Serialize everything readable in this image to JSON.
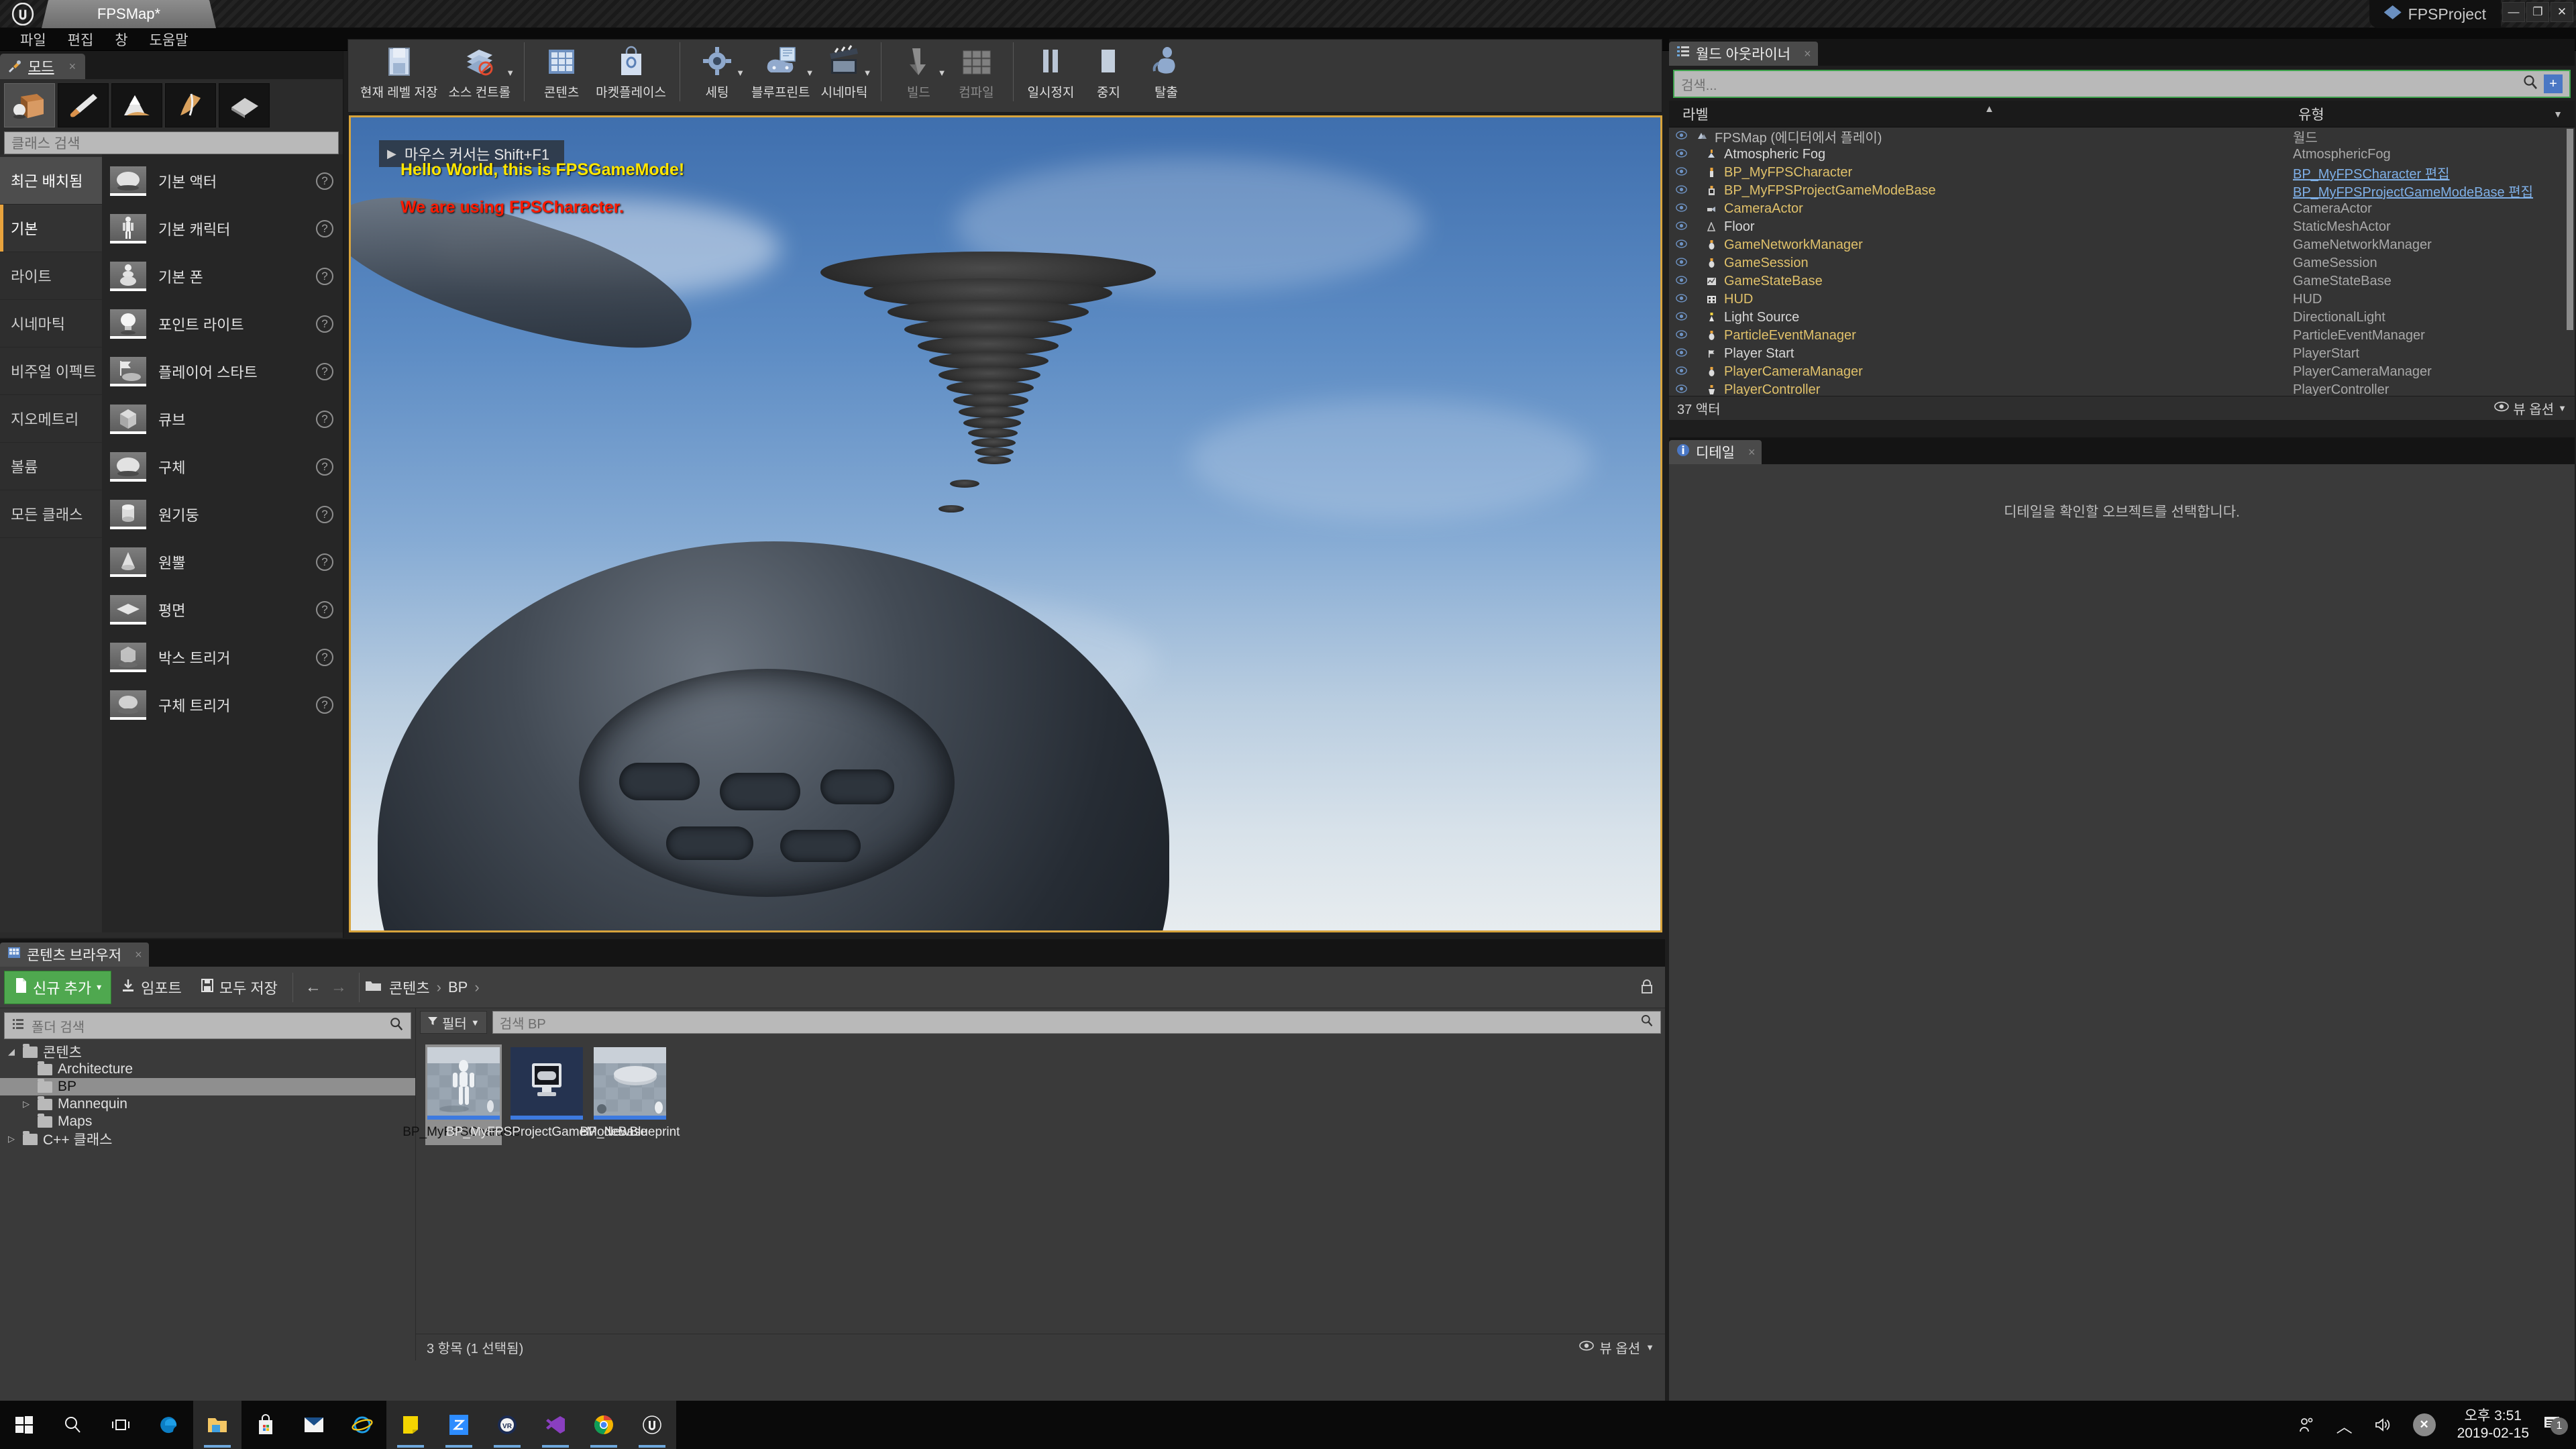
{
  "window": {
    "map_tab": "FPSMap*",
    "project_name": "FPSProject",
    "minimize": "—",
    "maximize": "❐",
    "close": "✕"
  },
  "menu": {
    "items": [
      "파일",
      "편집",
      "창",
      "도움말"
    ]
  },
  "modes_panel": {
    "tab_label": "모드",
    "tab_close": "×",
    "mode_buttons": [
      {
        "name": "place-mode",
        "icon": "box-icon",
        "active": true
      },
      {
        "name": "paint-mode",
        "icon": "brush-icon",
        "active": false
      },
      {
        "name": "landscape-mode",
        "icon": "landscape-icon",
        "active": false
      },
      {
        "name": "foliage-mode",
        "icon": "foliage-icon",
        "active": false
      },
      {
        "name": "geometry-edit-mode",
        "icon": "geometry-icon",
        "active": false
      }
    ],
    "search_placeholder": "클래스 검색",
    "categories": [
      {
        "label": "최근 배치됨",
        "state": "hover"
      },
      {
        "label": "기본",
        "state": "active"
      },
      {
        "label": "라이트",
        "state": ""
      },
      {
        "label": "시네마틱",
        "state": ""
      },
      {
        "label": "비주얼 이펙트",
        "state": ""
      },
      {
        "label": "지오메트리",
        "state": ""
      },
      {
        "label": "볼륨",
        "state": ""
      },
      {
        "label": "모든 클래스",
        "state": ""
      }
    ],
    "actors": [
      {
        "label": "기본 액터",
        "icon": "sphere-icon"
      },
      {
        "label": "기본 캐릭터",
        "icon": "character-icon"
      },
      {
        "label": "기본 폰",
        "icon": "pawn-icon"
      },
      {
        "label": "포인트 라이트",
        "icon": "bulb-icon"
      },
      {
        "label": "플레이어 스타트",
        "icon": "playerstart-icon"
      },
      {
        "label": "큐브",
        "icon": "cube-icon"
      },
      {
        "label": "구체",
        "icon": "sphere-icon"
      },
      {
        "label": "원기둥",
        "icon": "cylinder-icon"
      },
      {
        "label": "원뿔",
        "icon": "cone-icon"
      },
      {
        "label": "평면",
        "icon": "plane-icon"
      },
      {
        "label": "박스 트리거",
        "icon": "box-trigger-icon"
      },
      {
        "label": "구체 트리거",
        "icon": "sphere-trigger-icon"
      }
    ],
    "help_glyph": "?"
  },
  "toolbar": {
    "groups": [
      [
        {
          "label": "현재 레벨 저장",
          "icon": "save-icon",
          "caret": false,
          "dim": false
        },
        {
          "label": "소스 컨트롤",
          "icon": "source-control-icon",
          "caret": true,
          "dim": false
        }
      ],
      [
        {
          "label": "콘텐츠",
          "icon": "content-icon",
          "caret": false,
          "dim": false
        },
        {
          "label": "마켓플레이스",
          "icon": "marketplace-icon",
          "caret": false,
          "dim": false
        }
      ],
      [
        {
          "label": "세팅",
          "icon": "settings-gear-icon",
          "caret": true,
          "dim": false
        },
        {
          "label": "블루프린트",
          "icon": "blueprint-icon",
          "caret": true,
          "dim": false
        },
        {
          "label": "시네마틱",
          "icon": "cinematic-icon",
          "caret": true,
          "dim": false
        }
      ],
      [
        {
          "label": "빌드",
          "icon": "build-icon",
          "caret": true,
          "dim": true
        },
        {
          "label": "컴파일",
          "icon": "compile-icon",
          "caret": false,
          "dim": true
        }
      ],
      [
        {
          "label": "일시정지",
          "icon": "pause-icon",
          "caret": false,
          "dim": false
        },
        {
          "label": "중지",
          "icon": "stop-icon",
          "caret": false,
          "dim": false
        },
        {
          "label": "탈출",
          "icon": "eject-icon",
          "caret": false,
          "dim": false
        }
      ]
    ]
  },
  "viewport": {
    "cursor_hint": "마우스 커서는 Shift+F1",
    "cursor_arrow": "▶",
    "debug_line_1": "Hello World, this is FPSGameMode!",
    "debug_line_2": "We are using FPSCharacter.",
    "border_color": "#d8a43c"
  },
  "outliner": {
    "tab_label": "월드 아웃라이너",
    "tab_close": "×",
    "search_placeholder": "검색...",
    "search_icon": "magnifier-icon",
    "add_icon": "add-icon",
    "col_label": "라벨",
    "col_type": "유형",
    "sort_arrow": "▲",
    "filter_arrow": "▼",
    "rows": [
      {
        "label": "FPSMap (에디터에서 플레이)",
        "type": "월드",
        "indent": 0,
        "style": "world",
        "link": false,
        "icon": "world-icon"
      },
      {
        "label": "Atmospheric Fog",
        "type": "AtmosphericFog",
        "indent": 1,
        "style": "plain",
        "link": false,
        "icon": "fog-icon"
      },
      {
        "label": "BP_MyFPSCharacter",
        "type": "BP_MyFPSCharacter 편집",
        "indent": 1,
        "style": "yellow",
        "link": true,
        "icon": "bp-icon"
      },
      {
        "label": "BP_MyFPSProjectGameModeBase",
        "type": "BP_MyFPSProjectGameModeBase 편집",
        "indent": 1,
        "style": "yellow",
        "link": true,
        "icon": "bp-gm-icon"
      },
      {
        "label": "CameraActor",
        "type": "CameraActor",
        "indent": 1,
        "style": "yellow",
        "link": false,
        "icon": "camera-icon"
      },
      {
        "label": "Floor",
        "type": "StaticMeshActor",
        "indent": 1,
        "style": "plain",
        "link": false,
        "icon": "mesh-icon"
      },
      {
        "label": "GameNetworkManager",
        "type": "GameNetworkManager",
        "indent": 1,
        "style": "yellow",
        "link": false,
        "icon": "actor-icon"
      },
      {
        "label": "GameSession",
        "type": "GameSession",
        "indent": 1,
        "style": "yellow",
        "link": false,
        "icon": "actor-icon"
      },
      {
        "label": "GameStateBase",
        "type": "GameStateBase",
        "indent": 1,
        "style": "yellow",
        "link": false,
        "icon": "state-icon"
      },
      {
        "label": "HUD",
        "type": "HUD",
        "indent": 1,
        "style": "yellow",
        "link": false,
        "icon": "hud-icon"
      },
      {
        "label": "Light Source",
        "type": "DirectionalLight",
        "indent": 1,
        "style": "plain",
        "link": false,
        "icon": "light-icon"
      },
      {
        "label": "ParticleEventManager",
        "type": "ParticleEventManager",
        "indent": 1,
        "style": "yellow",
        "link": false,
        "icon": "actor-icon"
      },
      {
        "label": "Player Start",
        "type": "PlayerStart",
        "indent": 1,
        "style": "plain",
        "link": false,
        "icon": "playerstart-icon"
      },
      {
        "label": "PlayerCameraManager",
        "type": "PlayerCameraManager",
        "indent": 1,
        "style": "yellow",
        "link": false,
        "icon": "actor-icon"
      },
      {
        "label": "PlayerController",
        "type": "PlayerController",
        "indent": 1,
        "style": "yellow",
        "link": false,
        "icon": "controller-icon"
      }
    ],
    "footer_count": "37 액터",
    "footer_view_options": "뷰 옵션"
  },
  "details": {
    "tab_label": "디테일",
    "tab_close": "×",
    "empty_message": "디테일을 확인할 오브젝트를 선택합니다."
  },
  "content_browser": {
    "tab_label": "콘텐츠 브라우저",
    "tab_close": "×",
    "add_new": "신규 추가",
    "add_caret": "▾",
    "import": "임포트",
    "save_all": "모두 저장",
    "back_arrow": "←",
    "forward_arrow": "→",
    "breadcrumb": [
      "콘텐츠",
      "BP"
    ],
    "breadcrumb_sep": "›",
    "lock_icon": "lock-icon",
    "folder_search_placeholder": "폴더 검색",
    "filter_label": "필터",
    "asset_search_placeholder": "검색 BP",
    "tree": [
      {
        "label": "콘텐츠",
        "depth": 0,
        "twisty": "◢",
        "selected": false
      },
      {
        "label": "Architecture",
        "depth": 1,
        "twisty": "",
        "selected": false
      },
      {
        "label": "BP",
        "depth": 1,
        "twisty": "",
        "selected": true
      },
      {
        "label": "Mannequin",
        "depth": 1,
        "twisty": "▷",
        "selected": false
      },
      {
        "label": "Maps",
        "depth": 1,
        "twisty": "",
        "selected": false
      },
      {
        "label": "C++ 클래스",
        "depth": 0,
        "twisty": "▷",
        "selected": false
      }
    ],
    "assets": [
      {
        "label": "BP_MyFPSCharacter",
        "thumb": "mannequin-thumb",
        "selected": true
      },
      {
        "label": "BP_MyFPSProjectGameModeBase",
        "thumb": "gamemode-thumb",
        "selected": false
      },
      {
        "label": "BP_NewBlueprint",
        "thumb": "blueprint-thumb",
        "selected": false
      }
    ],
    "footer_status": "3 항목 (1 선택됨)",
    "footer_view_options": "뷰 옵션"
  },
  "taskbar": {
    "items": [
      {
        "name": "start-button",
        "icon": "windows-icon"
      },
      {
        "name": "search-button",
        "icon": "magnifier-icon"
      },
      {
        "name": "task-view-button",
        "icon": "taskview-icon"
      },
      {
        "name": "edge-button",
        "icon": "edge-icon",
        "running": false
      },
      {
        "name": "file-explorer-button",
        "icon": "folder-icon",
        "running": true
      },
      {
        "name": "store-button",
        "icon": "store-icon",
        "running": false
      },
      {
        "name": "mail-button",
        "icon": "mail-icon",
        "running": false
      },
      {
        "name": "ie-button",
        "icon": "ie-icon",
        "running": false
      },
      {
        "name": "sticky-notes-button",
        "icon": "notes-icon",
        "running": true
      },
      {
        "name": "zoom-button",
        "icon": "zoom-app-icon",
        "running": true
      },
      {
        "name": "vr-button",
        "icon": "vr-icon",
        "running": true
      },
      {
        "name": "vscode-button",
        "icon": "vscode-icon",
        "running": true
      },
      {
        "name": "chrome-button",
        "icon": "chrome-icon",
        "running": true
      },
      {
        "name": "unreal-button",
        "icon": "unreal-icon",
        "running": true
      }
    ],
    "tray": {
      "people_icon": "people-icon",
      "chevron_icon": "chevron-up-icon",
      "volume_icon": "volume-icon",
      "error_icon": "error-icon",
      "time": "오후 3:51",
      "date": "2019-02-15",
      "notification_icon": "notification-icon",
      "notification_count": "1"
    }
  }
}
